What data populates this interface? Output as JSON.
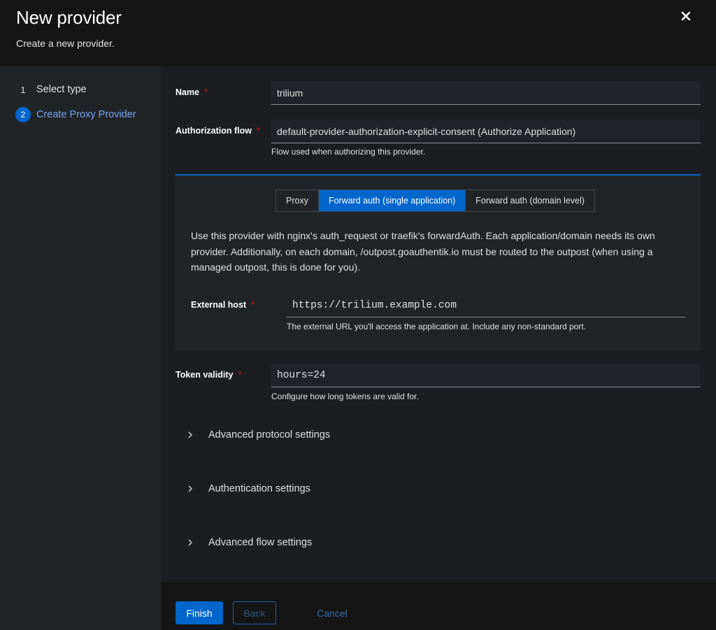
{
  "header": {
    "title": "New provider",
    "subtitle": "Create a new provider."
  },
  "nav": {
    "steps": [
      {
        "num": "1",
        "label": "Select type"
      },
      {
        "num": "2",
        "label": "Create Proxy Provider"
      }
    ]
  },
  "form": {
    "name": {
      "label": "Name",
      "value": "trilium"
    },
    "authorization_flow": {
      "label": "Authorization flow",
      "value": "default-provider-authorization-explicit-consent (Authorize Application)",
      "helper": "Flow used when authorizing this provider."
    },
    "mode_toggle": {
      "options": [
        "Proxy",
        "Forward auth (single application)",
        "Forward auth (domain level)"
      ],
      "selected": "Forward auth (single application)"
    },
    "mode_description": "Use this provider with nginx's auth_request or traefik's forwardAuth. Each application/domain needs its own provider. Additionally, on each domain, /outpost.goauthentik.io must be routed to the outpost (when using a managed outpost, this is done for you).",
    "external_host": {
      "label": "External host",
      "value": "https://trilium.example.com",
      "helper": "The external URL you'll access the application at. Include any non-standard port."
    },
    "token_validity": {
      "label": "Token validity",
      "value": "hours=24",
      "helper": "Configure how long tokens are valid for."
    },
    "required_marker": "*",
    "sections": [
      "Advanced protocol settings",
      "Authentication settings",
      "Advanced flow settings"
    ]
  },
  "footer": {
    "finish_label": "Finish",
    "back_label": "Back",
    "cancel_label": "Cancel"
  },
  "colors": {
    "accent": "#0066cc",
    "required": "#c9190b",
    "background": "#151515"
  }
}
